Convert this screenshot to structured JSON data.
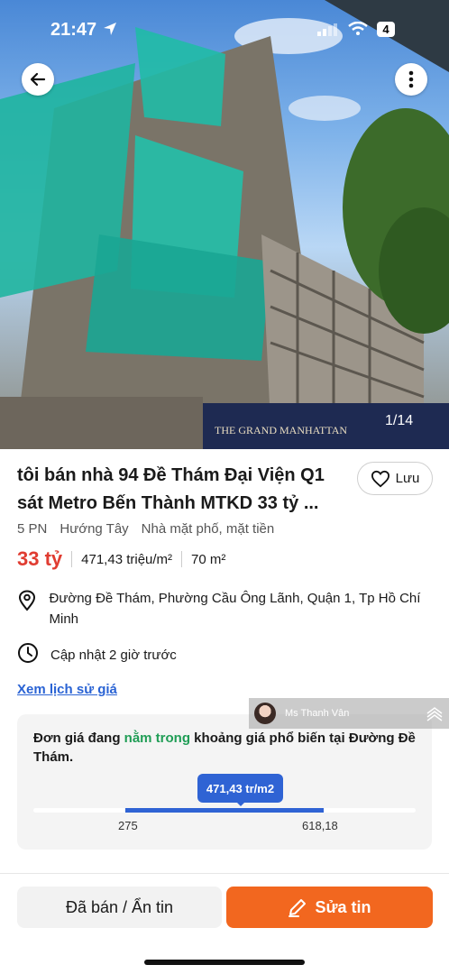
{
  "status_bar": {
    "time": "21:47",
    "battery": "4"
  },
  "gallery": {
    "counter": "1/14",
    "banner_text": "THE GRAND MANHATTAN"
  },
  "listing": {
    "title": "tôi bán nhà 94 Đề Thám  Đại Viện Q1 sát Metro Bến Thành  MTKD 33 tỷ ...",
    "save_label": "Lưu",
    "specs": {
      "bedrooms": "5 PN",
      "direction": "Hướng Tây",
      "type": "Nhà mặt phố, mặt tiền"
    },
    "price": "33 tỷ",
    "price_per_m2": "471,43 triệu/m²",
    "area": "70 m²",
    "address": "Đường Đề Thám, Phường Cầu Ông Lãnh, Quận 1, Tp Hồ Chí Minh",
    "updated": "Cập nhật 2 giờ trước",
    "history_link": "Xem lịch sử giá"
  },
  "watermark": {
    "name": "Ms Thanh Vân"
  },
  "price_range": {
    "text_before": "Đơn giá đang ",
    "text_highlight": "nằm trong",
    "text_after": " khoảng giá phổ biến tại Đường Đề Thám.",
    "current_label": "471,43 tr/m2",
    "min_label": "275",
    "max_label": "618,18",
    "min": 275,
    "max": 618.18,
    "current": 471.43
  },
  "actions": {
    "sold_label": "Đã bán / Ẩn tin",
    "edit_label": "Sửa tin"
  },
  "colors": {
    "price": "#e03c31",
    "accent_orange": "#f2671f",
    "accent_blue": "#2f63d4",
    "highlight_green": "#1f9d55"
  }
}
